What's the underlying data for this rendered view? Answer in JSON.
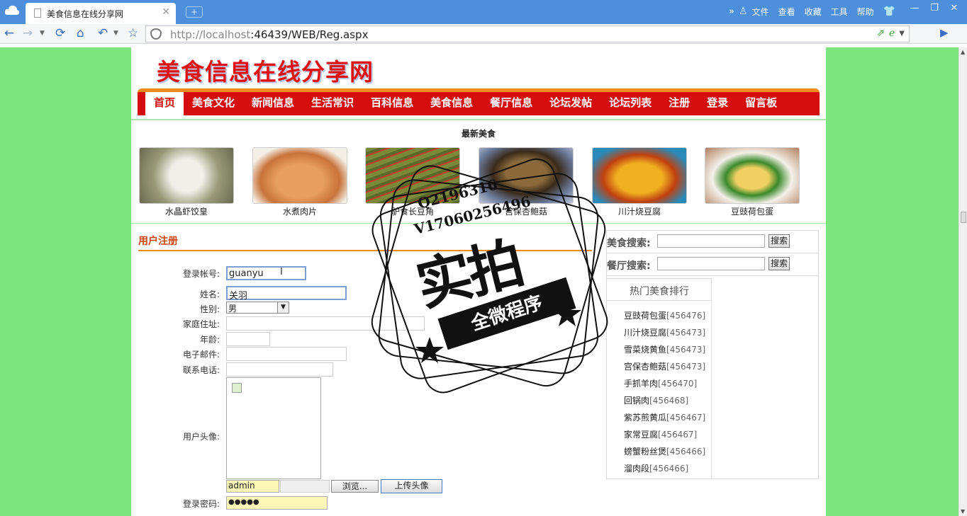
{
  "browser": {
    "tab_title": "美食信息在线分享网",
    "tab_close": "✕",
    "new_tab": "+",
    "url_host": "http://localhost",
    "url_rest": ":46439/WEB/Reg.aspx",
    "menu": [
      "文件",
      "查看",
      "收藏",
      "工具",
      "帮助"
    ],
    "window_buttons": [
      "—",
      "❐",
      "✕"
    ]
  },
  "site": {
    "logo": "美食信息在线分享网",
    "nav": [
      "首页",
      "美食文化",
      "新闻信息",
      "生活常识",
      "百科信息",
      "美食信息",
      "餐厅信息",
      "论坛发帖",
      "论坛列表",
      "注册",
      "登录",
      "留言板"
    ],
    "active_nav": "首页",
    "latest_title": "最新美食",
    "foods": [
      {
        "name": "水晶虾饺皇",
        "color": "#9a9a7a"
      },
      {
        "name": "水煮肉片",
        "color": "#c8733a"
      },
      {
        "name": "驴食长豆角",
        "color": "#7a8a3a"
      },
      {
        "name": "宫保杏鲍菇",
        "color": "#6a5a3a"
      },
      {
        "name": "川汁烧豆腐",
        "color": "#e0a020"
      },
      {
        "name": "豆豉荷包蛋",
        "color": "#c0a070"
      }
    ]
  },
  "register": {
    "title": "用户注册",
    "fields": {
      "account": {
        "label": "登录帐号:",
        "value": "guanyu"
      },
      "name": {
        "label": "姓名:",
        "value": "关羽"
      },
      "gender": {
        "label": "性别:",
        "value": "男"
      },
      "address": {
        "label": "家庭住址:",
        "value": ""
      },
      "age": {
        "label": "年龄:",
        "value": ""
      },
      "email": {
        "label": "电子邮件:",
        "value": ""
      },
      "phone": {
        "label": "联系电话:",
        "value": ""
      },
      "avatar": {
        "label": "用户头像:"
      },
      "upload_name": {
        "value": "admin"
      },
      "password": {
        "label": "登录密码:",
        "value": "●●●●●"
      }
    },
    "browse_button": "浏览...",
    "upload_button": "上传头像"
  },
  "sidebar": {
    "food_search_label": "美食搜索:",
    "restaurant_search_label": "餐厅搜索:",
    "search_button": "搜索",
    "hot_title": "热门美食排行",
    "hot_items": [
      {
        "name": "豆豉荷包蛋",
        "count": "[456476]"
      },
      {
        "name": "川汁烧豆腐",
        "count": "[456473]"
      },
      {
        "name": "雪菜烧黄鱼",
        "count": "[456473]"
      },
      {
        "name": "宫保杏鲍菇",
        "count": "[456473]"
      },
      {
        "name": "手抓羊肉",
        "count": "[456470]"
      },
      {
        "name": "回锅肉",
        "count": "[456468]"
      },
      {
        "name": "紫苏煎黄瓜",
        "count": "[456467]"
      },
      {
        "name": "家常豆腐",
        "count": "[456467]"
      },
      {
        "name": "螃蟹粉丝煲",
        "count": "[456466]"
      },
      {
        "name": "溜肉段",
        "count": "[456466]"
      }
    ]
  },
  "watermark": {
    "line1": "Q2196316",
    "line2": "V17060256496",
    "big": "实拍",
    "banner": "全微程序"
  }
}
